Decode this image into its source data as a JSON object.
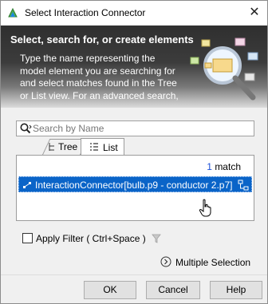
{
  "window": {
    "title": "Select Interaction Connector",
    "close_glyph": "✕"
  },
  "banner": {
    "title": "Select, search for, or create elements",
    "description_lines": [
      "Type the name representing the",
      "model element you are searching for",
      "and select matches found in the Tree",
      "or List view. For an advanced search,"
    ],
    "art_icon": "magnifier-over-elements-icon"
  },
  "search": {
    "placeholder": "Search by Name",
    "value": "",
    "icon": "search-icon"
  },
  "tabs": [
    {
      "label": "Tree",
      "icon": "tree-icon",
      "selected": false
    },
    {
      "label": "List",
      "icon": "list-icon",
      "selected": true
    }
  ],
  "results": {
    "match_count": "1",
    "match_label": "match",
    "items": [
      {
        "label": "InteractionConnector[bulb.p9 - conductor 2.p7]",
        "selected": true
      }
    ]
  },
  "filter": {
    "checkbox_checked": false,
    "label": "Apply Filter ( Ctrl+Space )",
    "icon": "funnel-icon"
  },
  "multiple_selection": {
    "label": "Multiple Selection",
    "icon": "chevron-right-circle-icon"
  },
  "buttons": {
    "ok": "OK",
    "cancel": "Cancel",
    "help": "Help"
  },
  "colors": {
    "selection": "#0a64c8",
    "match_count": "#1b4fd8",
    "banner_dark": "#2f2f2f"
  }
}
